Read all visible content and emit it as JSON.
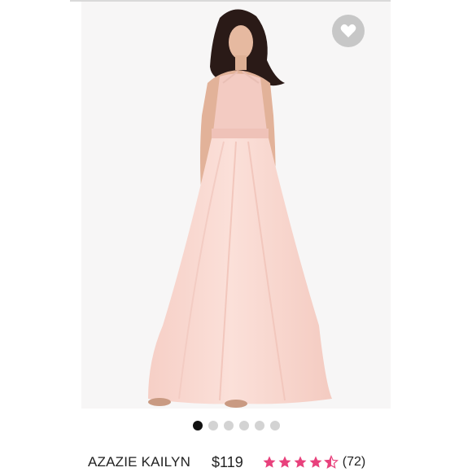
{
  "product": {
    "name": "AZAZIE KAILYN",
    "price": "$119",
    "rating": 4.5,
    "rating_max": 5,
    "review_count": "(72)"
  },
  "gallery": {
    "image_count": 6,
    "active_index": 0
  },
  "favorite": {
    "icon": "heart-icon"
  },
  "colors": {
    "star": "#e8417c",
    "dress": "#f9d8d0",
    "active_dot": "#111111",
    "inactive_dot": "#d3d3d3",
    "favorite_bg": "#c7c7c7"
  }
}
